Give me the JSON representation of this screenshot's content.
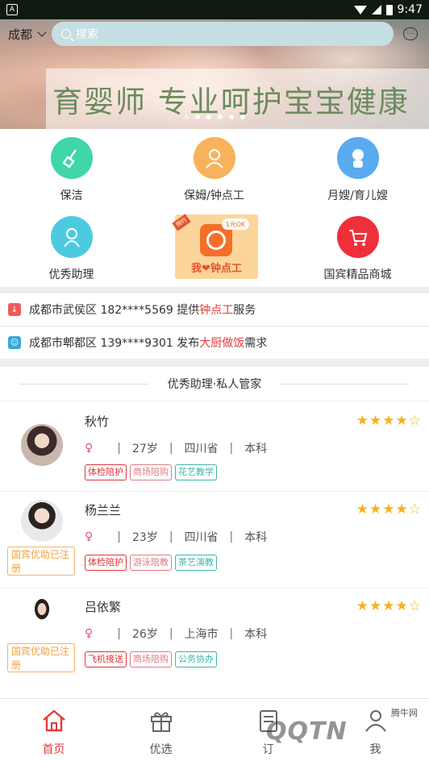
{
  "status_bar": {
    "time": "9:47"
  },
  "header": {
    "city": "成都",
    "search_placeholder": "搜索"
  },
  "banner": {
    "tagline": "育婴师 专业呵护宝宝健康",
    "page_count": 6,
    "active_index": 0
  },
  "services": [
    {
      "label": "保洁",
      "icon": "broom-icon",
      "color": "#3fd6a8"
    },
    {
      "label": "保姆/钟点工",
      "icon": "nanny-icon",
      "color": "#f8b25c"
    },
    {
      "label": "月嫂/育儿嫂",
      "icon": "baby-icon",
      "color": "#5aaaf0"
    },
    {
      "label": "优秀助理",
      "icon": "assistant-icon",
      "color": "#4ccbe0"
    },
    {
      "label": "国宾精品商城",
      "icon": "shopping-cart-icon",
      "color": "#ef2f3a"
    }
  ],
  "promo": {
    "bubble": "1元OK",
    "text": "我❤钟点工"
  },
  "notices": [
    {
      "prefix": "成都市武侯区 182****5569 提供",
      "highlight": "钟点工",
      "suffix": "服务"
    },
    {
      "prefix": "成都市郫都区 139****9301 发布",
      "highlight": "大厨做饭",
      "suffix": "需求"
    }
  ],
  "section_title": "优秀助理·私人管家",
  "assistants": [
    {
      "name": "秋竹",
      "sex": "♀",
      "age": "27岁",
      "province": "四川省",
      "education": "本科",
      "tags": [
        "体检陪护",
        "商场陪购",
        "花艺教学"
      ],
      "badge": "",
      "rating": 4.5
    },
    {
      "name": "杨兰兰",
      "sex": "♀",
      "age": "23岁",
      "province": "四川省",
      "education": "本科",
      "tags": [
        "体检陪护",
        "游泳陪教",
        "茶艺演教"
      ],
      "badge": "国宾优助已注册",
      "rating": 4.5
    },
    {
      "name": "吕依繁",
      "sex": "♀",
      "age": "26岁",
      "province": "上海市",
      "education": "本科",
      "tags": [
        "飞机接送",
        "商场陪购",
        "公务协办"
      ],
      "badge": "国宾优助已注册",
      "rating": 4.5
    }
  ],
  "nav": [
    {
      "label": "首页",
      "icon": "home-icon",
      "active": true
    },
    {
      "label": "优选",
      "icon": "gift-icon",
      "active": false
    },
    {
      "label": "订",
      "icon": "order-icon",
      "active": false
    },
    {
      "label": "我",
      "icon": "user-icon",
      "active": false
    }
  ],
  "watermark": {
    "text": "QQTN",
    "small": "腾牛网"
  }
}
